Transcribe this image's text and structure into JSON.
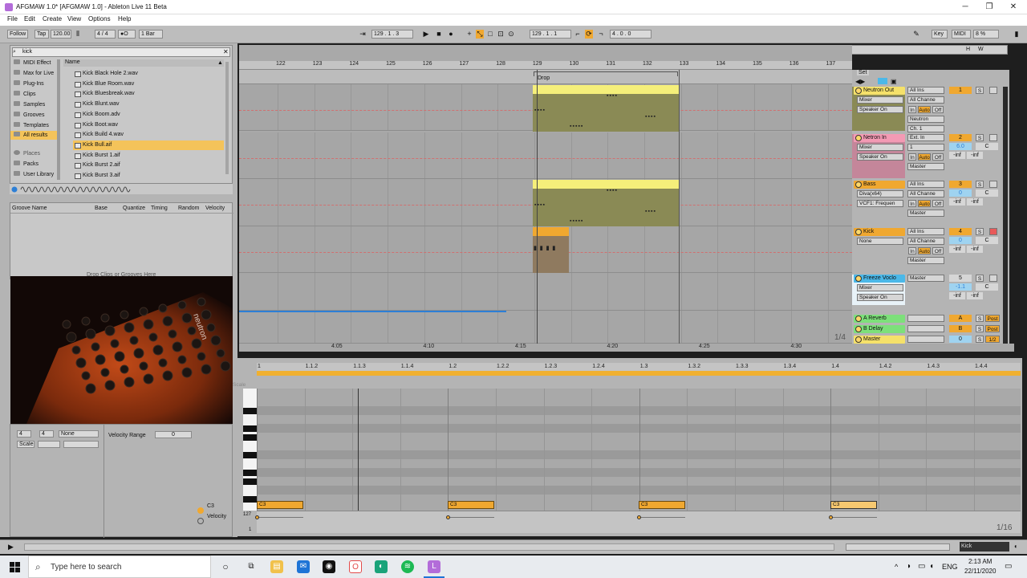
{
  "window": {
    "title": "AFGMAW 1.0* [AFGMAW 1.0] - Ableton Live 11 Beta",
    "minimize": "─",
    "maximize": "❐",
    "close": "✕"
  },
  "menu": [
    "File",
    "Edit",
    "Create",
    "View",
    "Options",
    "Help"
  ],
  "toolbar": {
    "follow": "Follow",
    "tap": "Tap",
    "tempo": "120.00",
    "signature": "4 / 4",
    "metro": "●O",
    "quantize": "1 Bar",
    "arrangement_position": "129 . 1 . 3",
    "loop_start": "129 . 1 . 1",
    "loop_length": "4 . 0 . 0",
    "key": "Key",
    "midi": "MIDI",
    "cpu": "8 %"
  },
  "browser": {
    "search_value": "kick",
    "categories": [
      "MIDI Effect",
      "Max for Live",
      "Plug-Ins",
      "Clips",
      "Samples",
      "Grooves",
      "Templates",
      "All results"
    ],
    "places": [
      "Places",
      "Packs",
      "User Library"
    ],
    "column_header": "Name",
    "files": [
      "Kick Black Hole 2.wav",
      "Kick Blue Room.wav",
      "Kick Bluesbreak.wav",
      "Kick Blunt.wav",
      "Kick Boom.adv",
      "Kick Boot.wav",
      "Kick Build 4.wav",
      "Kick Bull.aif",
      "Kick Burst 1.aif",
      "Kick Burst 2.aif",
      "Kick Burst 3.aif"
    ],
    "selected_file": "Kick Bull.aif"
  },
  "groove": {
    "headers": [
      "Groove Name",
      "Base",
      "Quantize",
      "Timing",
      "Random",
      "Velocity"
    ],
    "placeholder": "Drop Clips or Grooves Here"
  },
  "clip_props": {
    "sig_num": "4",
    "sig_den": "4",
    "groove": "None",
    "scale": "Scale",
    "velocity_range_label": "Velocity Range",
    "velocity_range_value": "0"
  },
  "arrangement": {
    "bars": [
      "122",
      "123",
      "124",
      "125",
      "126",
      "127",
      "128",
      "129",
      "130",
      "131",
      "132",
      "133",
      "134",
      "135",
      "136",
      "137"
    ],
    "locator": "Drop",
    "set_label": "Set",
    "zoom_ratio": "1/4",
    "time_ticks": [
      "4:05",
      "4:10",
      "4:15",
      "4:20",
      "4:25",
      "4:30"
    ]
  },
  "tracks": [
    {
      "name": "Neutron Out",
      "color": "#f5e16a",
      "device": "Mixer",
      "out": "Speaker On",
      "input_type": "All Ins",
      "channel": "All Channe",
      "extra1": "Neutron",
      "extra2": "Ch. 1",
      "num": "1",
      "vol": "",
      "pan": ""
    },
    {
      "name": "Netron In",
      "color": "#f39ab4",
      "device": "Mixer",
      "out": "Speaker On",
      "input_type": "Ext. In",
      "channel": "1",
      "extra1": "Master",
      "extra2": "",
      "num": "2",
      "vol": "6.0",
      "pan": "C"
    },
    {
      "name": "Bass",
      "color": "#f0a830",
      "device": "Diva(x64)",
      "out": "VCF1: Frequen",
      "input_type": "All Ins",
      "channel": "All Channe",
      "extra1": "Master",
      "extra2": "",
      "num": "3",
      "vol": "0",
      "pan": "C"
    },
    {
      "name": "Kick",
      "color": "#f0a830",
      "device": "None",
      "out": "",
      "input_type": "All Ins",
      "channel": "All Channe",
      "extra1": "Master",
      "extra2": "",
      "num": "4",
      "vol": "0",
      "pan": "C"
    },
    {
      "name": "Freeze Voclo",
      "color": "#4bb8e8",
      "device": "Mixer",
      "out": "Speaker On",
      "input_type": "Master",
      "channel": "",
      "extra1": "",
      "extra2": "",
      "num": "5",
      "vol": "-1.1",
      "pan": "C"
    }
  ],
  "returns": [
    {
      "name": "A Reverb",
      "color": "#7de07a",
      "letter": "A",
      "post": "Post"
    },
    {
      "name": "B Delay",
      "color": "#7de07a",
      "letter": "B",
      "post": "Post"
    },
    {
      "name": "Master",
      "color": "#f5e16a",
      "letter": "0",
      "post": "1/2"
    }
  ],
  "mixer_labels": {
    "in": "In",
    "auto": "Auto",
    "off": "Off",
    "solo": "S",
    "ninf": "-inf"
  },
  "clip_editor": {
    "ruler": [
      "1",
      "1.1.2",
      "1.1.3",
      "1.1.4",
      "1.2",
      "1.2.2",
      "1.2.3",
      "1.2.4",
      "1.3",
      "1.3.2",
      "1.3.3",
      "1.3.4",
      "1.4",
      "1.4.2",
      "1.4.3",
      "1.4.4"
    ],
    "notes": [
      "C3",
      "C3",
      "C3",
      "C3"
    ],
    "key_label": "C3",
    "velocity_label": "Velocity",
    "velocity_max": "127",
    "velocity_min": "1",
    "grid": "1/16",
    "scale_tab": "Scale"
  },
  "status": {
    "track": "Kick"
  },
  "taskbar": {
    "search_placeholder": "Type here to search",
    "lang": "ENG",
    "time": "2:13 AM",
    "date": "22/11/2020"
  }
}
